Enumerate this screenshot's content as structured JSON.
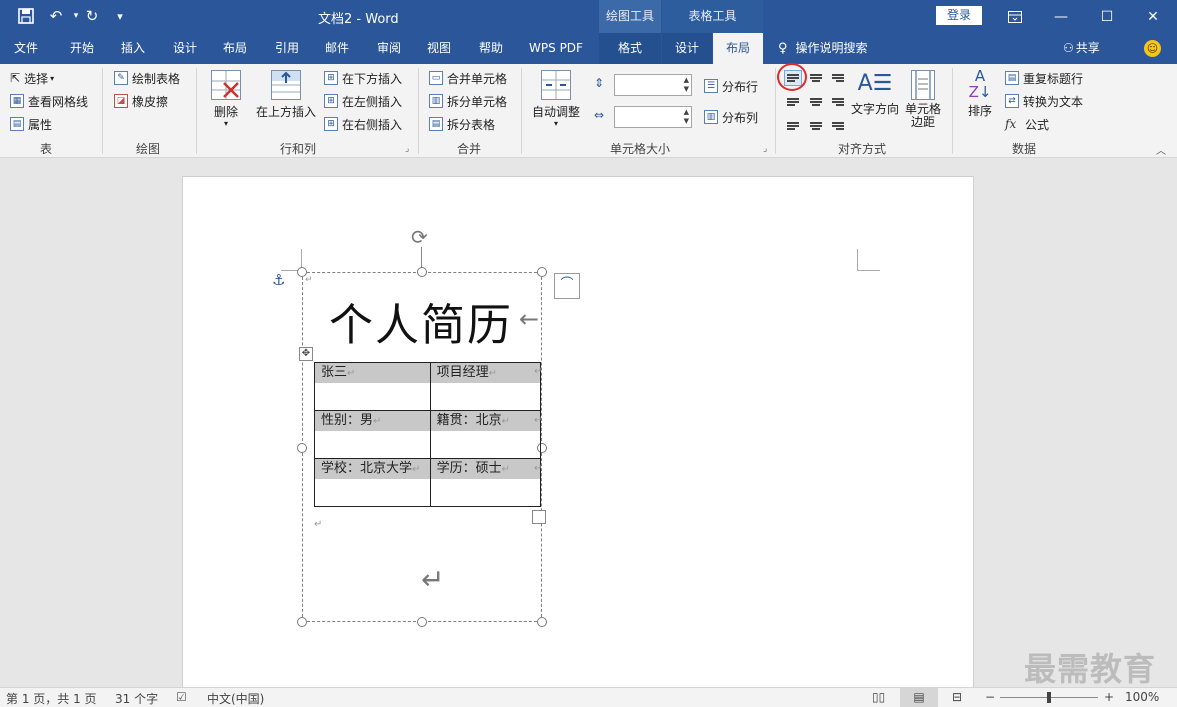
{
  "titlebar": {
    "doc_title": "文档2  -  Word",
    "context_draw": "绘图工具",
    "context_table": "表格工具",
    "login": "登录"
  },
  "tabs": [
    "文件",
    "开始",
    "插入",
    "设计",
    "布局",
    "引用",
    "邮件",
    "审阅",
    "视图",
    "帮助",
    "WPS PDF",
    "格式",
    "设计",
    "布局"
  ],
  "active_tab": "布局",
  "tell_me": "操作说明搜索",
  "share": "共享",
  "ribbon": {
    "table_group": {
      "label": "表",
      "select": "选择",
      "gridlines": "查看网格线",
      "properties": "属性"
    },
    "draw_group": {
      "label": "绘图",
      "draw_table": "绘制表格",
      "eraser": "橡皮擦"
    },
    "rowcol_group": {
      "label": "行和列",
      "delete": "删除",
      "insert_above": "在上方插入",
      "insert_below": "在下方插入",
      "insert_left": "在左侧插入",
      "insert_right": "在右侧插入"
    },
    "merge_group": {
      "label": "合并",
      "merge_cells": "合并单元格",
      "split_cells": "拆分单元格",
      "split_table": "拆分表格"
    },
    "cellsize_group": {
      "label": "单元格大小",
      "autofit": "自动调整",
      "dist_rows": "分布行",
      "dist_cols": "分布列"
    },
    "align_group": {
      "label": "对齐方式",
      "text_direction": "文字方向",
      "cell_margins_1": "单元格",
      "cell_margins_2": "边距"
    },
    "data_group": {
      "label": "数据",
      "sort": "排序",
      "repeat_header": "重复标题行",
      "convert_text": "转换为文本",
      "formula": "公式"
    }
  },
  "document": {
    "heading": "个人简历",
    "table": [
      [
        "张三",
        "项目经理"
      ],
      [
        "性别：男",
        "籍贯：北京"
      ],
      [
        "学校：北京大学",
        "学历：硕士"
      ]
    ]
  },
  "statusbar": {
    "page": "第 1 页，共 1 页",
    "words": "31 个字",
    "language": "中文(中国)",
    "zoom": "100%",
    "zoom_level": 1.0
  },
  "watermark": "最需教育",
  "colors": {
    "title_bar": "#2b579a",
    "ribbon": "#f3f3f3",
    "doc_bg": "#e6e6e6",
    "cell_shading": "#c8c8c8"
  }
}
